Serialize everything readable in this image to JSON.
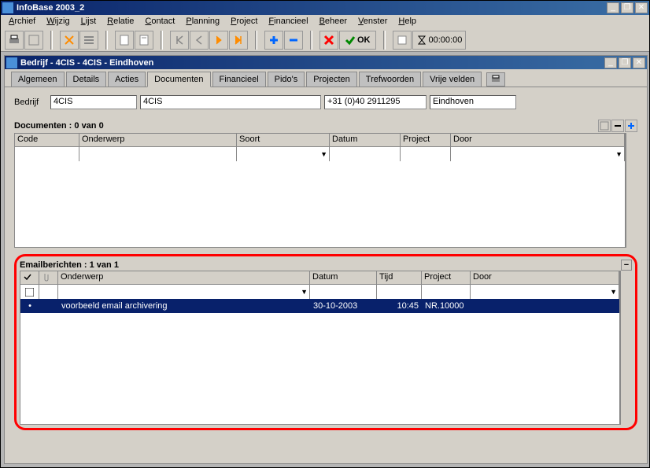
{
  "app": {
    "title": "InfoBase 2003_2"
  },
  "menu": [
    "Archief",
    "Wijzig",
    "Lijst",
    "Relatie",
    "Contact",
    "Planning",
    "Project",
    "Financieel",
    "Beheer",
    "Venster",
    "Help"
  ],
  "toolbar": {
    "ok": "OK",
    "time": "00:00:00"
  },
  "child": {
    "title": "Bedrijf - 4CIS - 4CIS - Eindhoven"
  },
  "tabs": [
    "Algemeen",
    "Details",
    "Acties",
    "Documenten",
    "Financieel",
    "Pido's",
    "Projecten",
    "Trefwoorden",
    "Vrije velden"
  ],
  "active_tab": 3,
  "bedrijf": {
    "label": "Bedrijf",
    "code": "4CIS",
    "naam": "4CIS",
    "phone": "+31 (0)40 2911295",
    "plaats": "Eindhoven"
  },
  "documenten": {
    "title": "Documenten : 0 van 0",
    "cols": [
      "Code",
      "Onderwerp",
      "Soort",
      "Datum",
      "Project",
      "Door"
    ]
  },
  "email": {
    "title": "Emailberichten : 1 van 1",
    "cols": [
      "✔",
      "📎",
      "Onderwerp",
      "Datum",
      "Tijd",
      "Project",
      "Door"
    ],
    "rows": [
      {
        "mark": "•",
        "onderwerp": "voorbeeld email archivering",
        "datum": "30-10-2003",
        "tijd": "10:45",
        "project": "NR.10000",
        "door": ""
      }
    ]
  }
}
